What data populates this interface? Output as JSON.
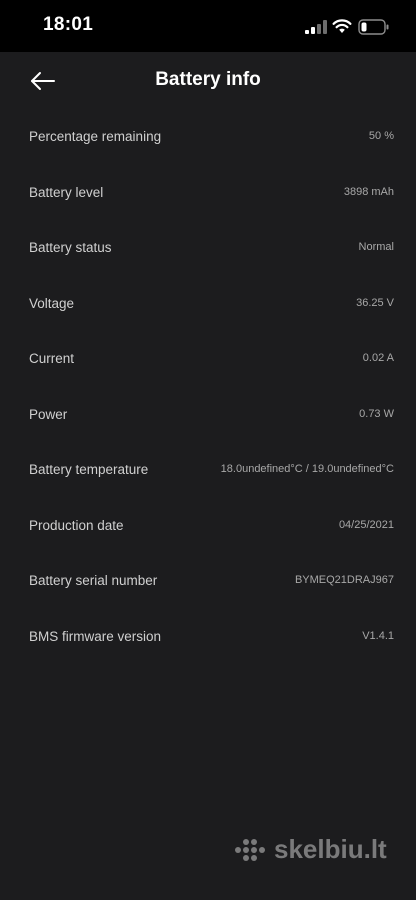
{
  "status_bar": {
    "time": "18:01"
  },
  "header": {
    "title": "Battery info",
    "back_icon": "arrow-left-icon"
  },
  "rows": [
    {
      "label": "Percentage remaining",
      "value": "50 %"
    },
    {
      "label": "Battery level",
      "value": "3898 mAh"
    },
    {
      "label": "Battery status",
      "value": "Normal"
    },
    {
      "label": "Voltage",
      "value": "36.25 V"
    },
    {
      "label": "Current",
      "value": "0.02 A"
    },
    {
      "label": "Power",
      "value": "0.73 W"
    },
    {
      "label": "Battery temperature",
      "value": "18.0undefined°C / 19.0undefined°C"
    },
    {
      "label": "Production date",
      "value": "04/25/2021"
    },
    {
      "label": "Battery serial number",
      "value": "BYMEQ21DRAJ967"
    },
    {
      "label": "BMS firmware version",
      "value": "V1.4.1"
    }
  ],
  "watermark": {
    "text": "skelbiu.lt"
  },
  "colors": {
    "background": "#1c1c1e",
    "status_bar": "#000000",
    "label": "#d0d0d0",
    "value": "#a8a8a8"
  }
}
